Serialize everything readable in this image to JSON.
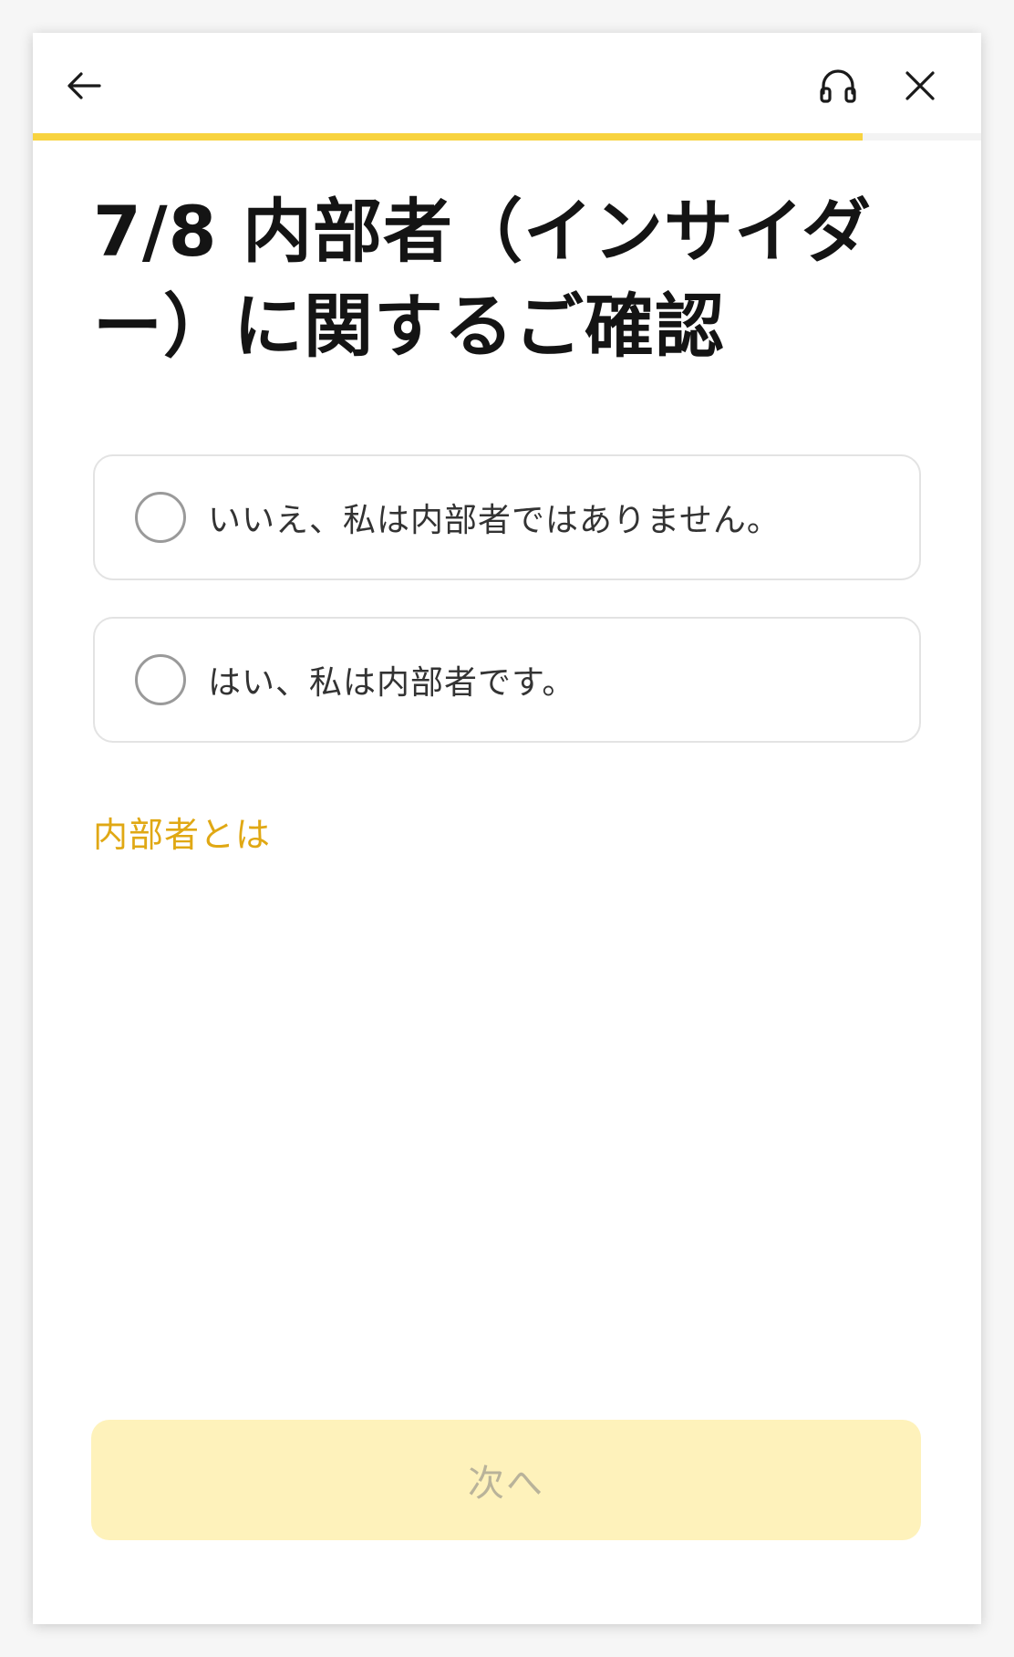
{
  "header": {
    "progress": 0.875,
    "accent_color": "#f8d33f",
    "icons": [
      "back-arrow-icon",
      "headset-icon",
      "close-icon"
    ]
  },
  "title": "7/8 内部者（インサイダー）に関するご確認",
  "options": [
    {
      "label": "いいえ、私は内部者ではありません。",
      "selected": false
    },
    {
      "label": "はい、私は内部者です。",
      "selected": false
    }
  ],
  "info_link": "内部者とは",
  "next_button": {
    "label": "次へ",
    "disabled": true
  }
}
